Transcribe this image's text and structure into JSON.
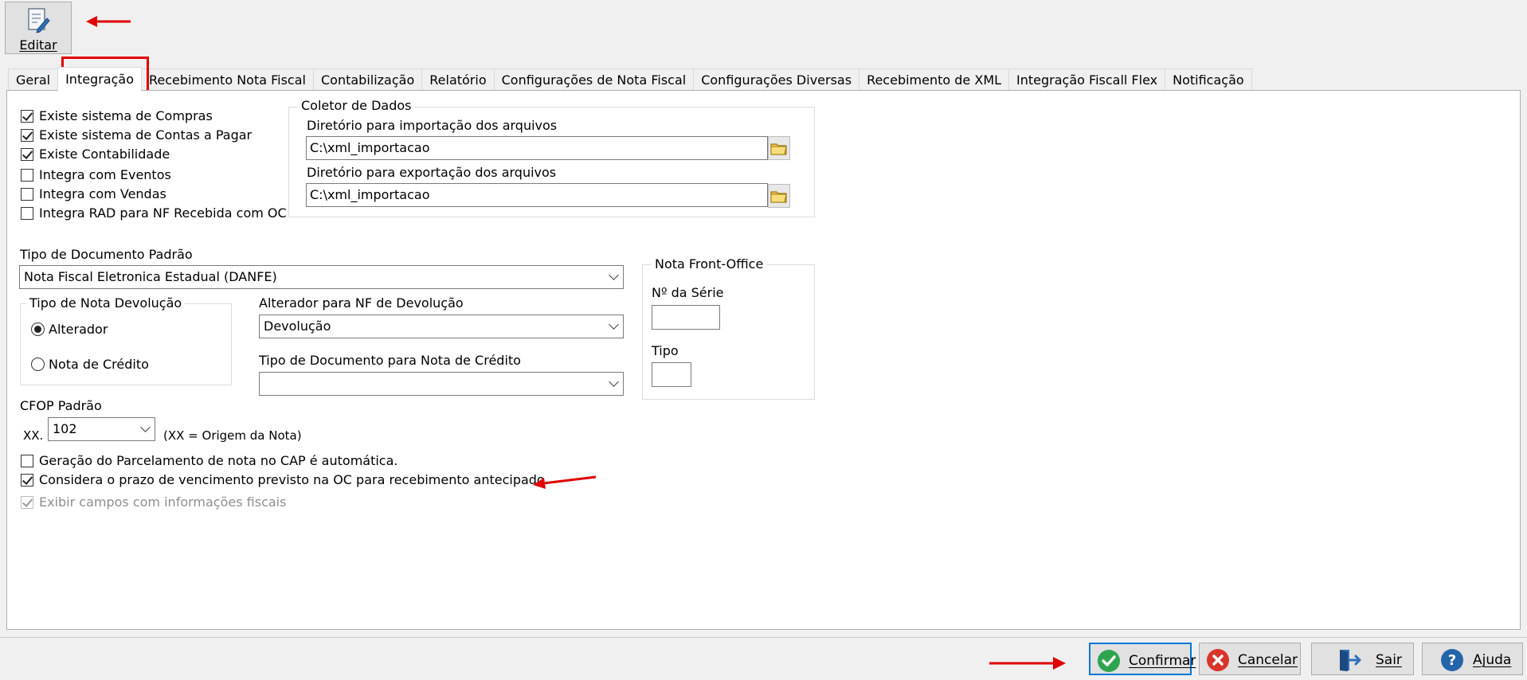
{
  "toolbar": {
    "edit_label": "Editar"
  },
  "tabs": [
    "Geral",
    "Integração",
    "Recebimento Nota Fiscal",
    "Contabilização",
    "Relatório",
    "Configurações de Nota Fiscal",
    "Configurações Diversas",
    "Recebimento de XML",
    "Integração Fiscall Flex",
    "Notificação"
  ],
  "active_tab": "Integração",
  "checkboxes": {
    "compras": {
      "label": "Existe sistema de Compras",
      "checked": true
    },
    "contas_pagar": {
      "label": "Existe sistema de Contas a Pagar",
      "checked": true
    },
    "contabilidade": {
      "label": "Existe Contabilidade",
      "checked": true
    },
    "eventos": {
      "label": "Integra com Eventos",
      "checked": false
    },
    "vendas": {
      "label": "Integra com Vendas",
      "checked": false
    },
    "rad": {
      "label": "Integra RAD para NF Recebida com OC",
      "checked": false
    },
    "parcelamento": {
      "label": "Geração do Parcelamento de nota no CAP é automática.",
      "checked": false
    },
    "prazo_oc": {
      "label": "Considera o prazo de vencimento previsto na OC para recebimento antecipado.",
      "checked": true
    },
    "campos_fiscais": {
      "label": "Exibir campos com informações fiscais",
      "checked": true,
      "disabled": true
    }
  },
  "coletor": {
    "title": "Coletor de Dados",
    "import_label": "Diretório para importação dos arquivos",
    "import_value": "C:\\xml_importacao",
    "export_label": "Diretório para exportação dos arquivos",
    "export_value": "C:\\xml_importacao"
  },
  "tipo_documento": {
    "label": "Tipo de Documento Padrão",
    "value": "Nota Fiscal Eletronica Estadual (DANFE)"
  },
  "tipo_nota_devolucao": {
    "title": "Tipo de Nota Devolução",
    "options": [
      "Alterador",
      "Nota de Crédito"
    ],
    "selected": "Alterador"
  },
  "alterador_nf": {
    "label": "Alterador para NF de Devolução",
    "value": "Devolução"
  },
  "tipo_doc_credito": {
    "label": "Tipo de Documento para Nota de Crédito",
    "value": ""
  },
  "front_office": {
    "title": "Nota Front-Office",
    "serie_label": "Nº da Série",
    "serie_value": "",
    "tipo_label": "Tipo",
    "tipo_value": ""
  },
  "cfop": {
    "label": "CFOP Padrão",
    "prefix": "XX.",
    "value": "102",
    "hint": "(XX = Origem da Nota)"
  },
  "buttons": {
    "confirmar": "Confirmar",
    "cancelar": "Cancelar",
    "sair": "Sair",
    "ajuda": "Ajuda"
  },
  "colors": {
    "annotation_red": "#e00000",
    "focus_blue": "#0078d7",
    "confirm_green": "#2ea44f",
    "cancel_red": "#d9342b",
    "help_blue": "#2364aa"
  }
}
